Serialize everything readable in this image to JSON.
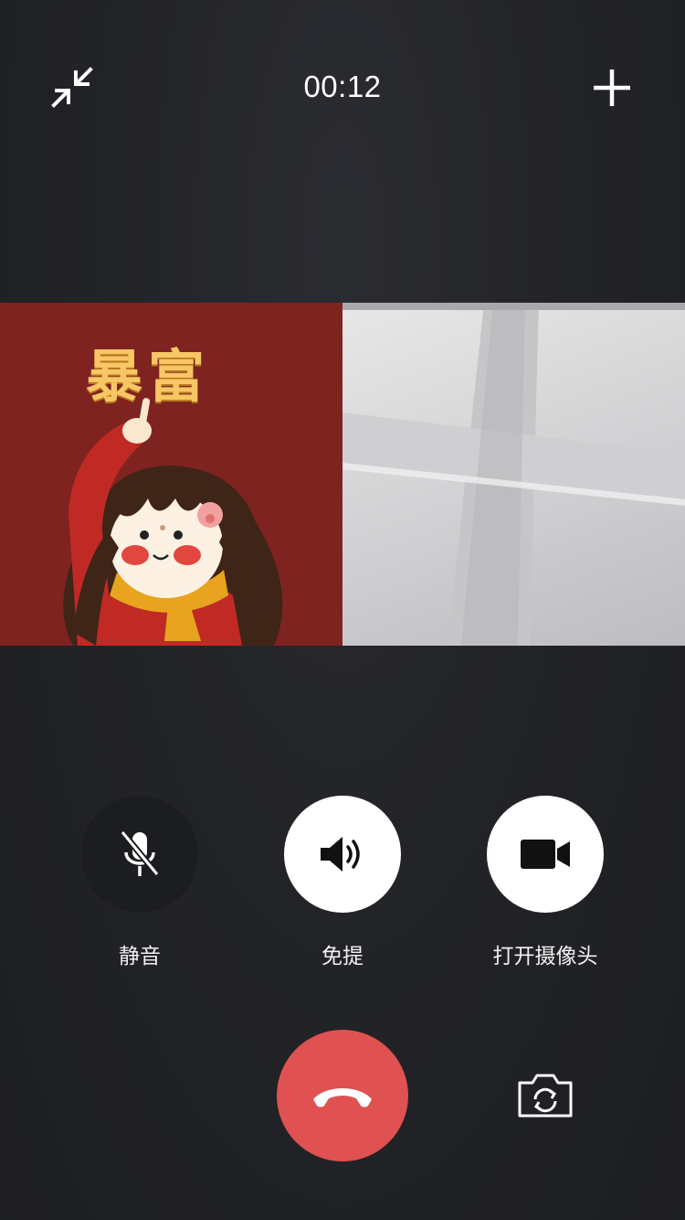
{
  "call": {
    "duration": "00:12"
  },
  "remote_video": {
    "overlay_text": "暴富"
  },
  "controls": {
    "mute_label": "静音",
    "speaker_label": "免提",
    "camera_label": "打开摄像头"
  },
  "icons": {
    "minimize": "minimize-icon",
    "add": "plus-icon",
    "mute": "mic-off-icon",
    "speaker": "speaker-icon",
    "camera": "video-camera-icon",
    "hangup": "phone-hangup-icon",
    "switch_camera": "camera-switch-icon"
  },
  "colors": {
    "background": "#232428",
    "hangup": "#e05151",
    "button_light": "#ffffff",
    "button_dark": "#1c1d20",
    "remote_bg": "#7e2320"
  }
}
